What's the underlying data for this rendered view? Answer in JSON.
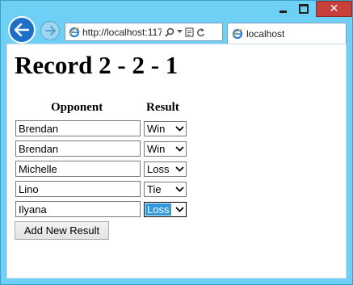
{
  "browser": {
    "address_url": "http://localhost:117",
    "tab_title": "localhost",
    "icons": [
      "back-arrow-icon",
      "forward-arrow-icon",
      "ie-logo-icon",
      "search-icon",
      "dropdown-icon",
      "compatibility-icon",
      "refresh-icon",
      "minimize-icon",
      "maximize-icon",
      "close-icon"
    ]
  },
  "page": {
    "title": "Record 2 - 2 - 1",
    "headers": {
      "opponent": "Opponent",
      "result": "Result"
    },
    "rows": [
      {
        "opponent": "Brendan",
        "result": "Win"
      },
      {
        "opponent": "Brendan",
        "result": "Win"
      },
      {
        "opponent": "Michelle",
        "result": "Loss"
      },
      {
        "opponent": "Lino",
        "result": "Tie"
      },
      {
        "opponent": "Ilyana",
        "result": "Loss"
      }
    ],
    "add_button_label": "Add New Result"
  },
  "colors": {
    "titlebar": "#6ed0f5",
    "close_button": "#c7403a",
    "back_button": "#1e6fc8",
    "selection_highlight": "#3399dd"
  }
}
